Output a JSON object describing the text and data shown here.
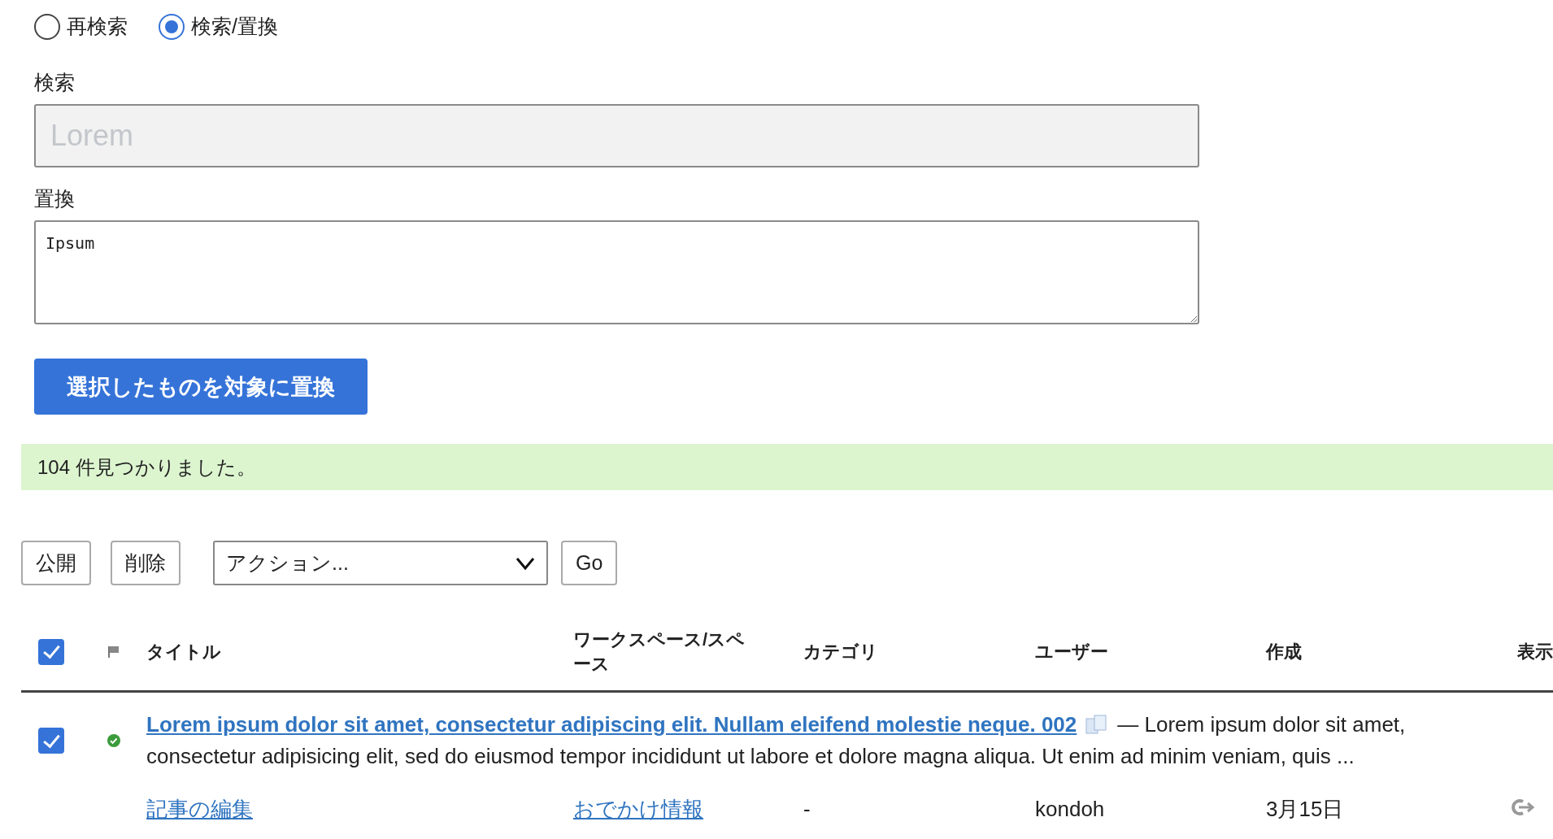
{
  "mode_radios": [
    {
      "label": "再検索",
      "selected": false
    },
    {
      "label": "検索/置換",
      "selected": true
    }
  ],
  "search": {
    "label": "検索",
    "value": "Lorem",
    "disabled": true
  },
  "replace": {
    "label": "置換",
    "value": "Ipsum"
  },
  "replace_button": "選択したものを対象に置換",
  "result_message": "104 件見つかりました。",
  "toolbar": {
    "buttons": [
      "公開",
      "削除"
    ],
    "action_select": "アクション...",
    "go_button": "Go"
  },
  "table": {
    "select_all_checked": true,
    "columns": [
      "タイトル",
      "ワークスペース/スペース",
      "カテゴリ",
      "ユーザー",
      "作成",
      "表示"
    ],
    "rows": [
      {
        "checked": true,
        "published": true,
        "title": "Lorem ipsum dolor sit amet, consectetur adipiscing elit. Nullam eleifend molestie neque. 002",
        "excerpt_lines": [
          "— Lorem ipsum dolor sit amet,",
          "consectetur adipisicing elit, sed do eiusmod tempor incididunt ut labore et dolore magna aliqua. Ut enim ad minim veniam, quis ..."
        ],
        "edit_link": "記事の編集",
        "workspace": "おでかけ情報",
        "category": "-",
        "user": "kondoh",
        "created": "3月15日"
      }
    ]
  }
}
